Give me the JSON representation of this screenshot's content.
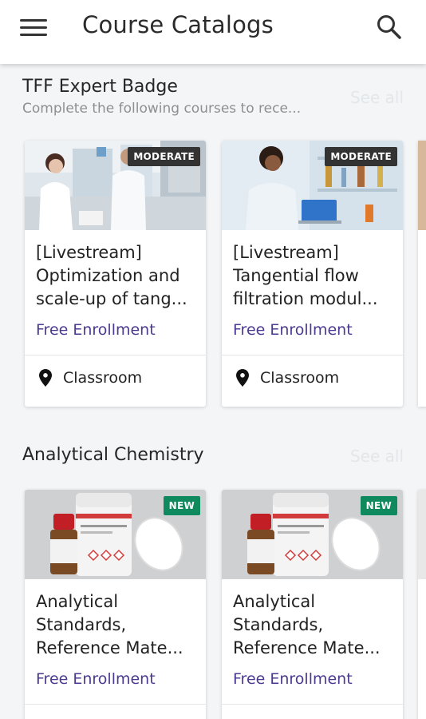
{
  "appbar": {
    "title": "Course Catalogs",
    "menu_icon": "hamburger-menu-icon",
    "search_icon": "search-icon"
  },
  "sections": [
    {
      "title": "TFF Expert Badge",
      "subtitle": "Complete the following courses to rece...",
      "see_all": "See all",
      "cards": [
        {
          "badge": "MODERATE",
          "title": "[Livestream] Optimization and scale-up of tang...",
          "price": "Free Enrollment",
          "location": "Classroom",
          "image": "lab-scientists-photo"
        },
        {
          "badge": "MODERATE",
          "title": "[Livestream] Tangential flow filtration modul...",
          "price": "Free Enrollment",
          "location": "Classroom",
          "image": "lab-scientist-laptop-photo"
        }
      ]
    },
    {
      "title": "Analytical Chemistry",
      "see_all": "See all",
      "cards": [
        {
          "badge": "NEW",
          "title": "Analytical Standards, Reference Mate...",
          "price": "Free Enrollment",
          "image": "chemical-bottles-photo"
        },
        {
          "badge": "NEW",
          "title": "Analytical Standards, Reference Mate...",
          "price": "Free Enrollment",
          "image": "chemical-bottles-photo"
        }
      ]
    }
  ],
  "colors": {
    "price": "#4b3a90",
    "badge_moderate": "#333333",
    "badge_new": "#0f8a5f",
    "background": "#f3f5f7"
  }
}
